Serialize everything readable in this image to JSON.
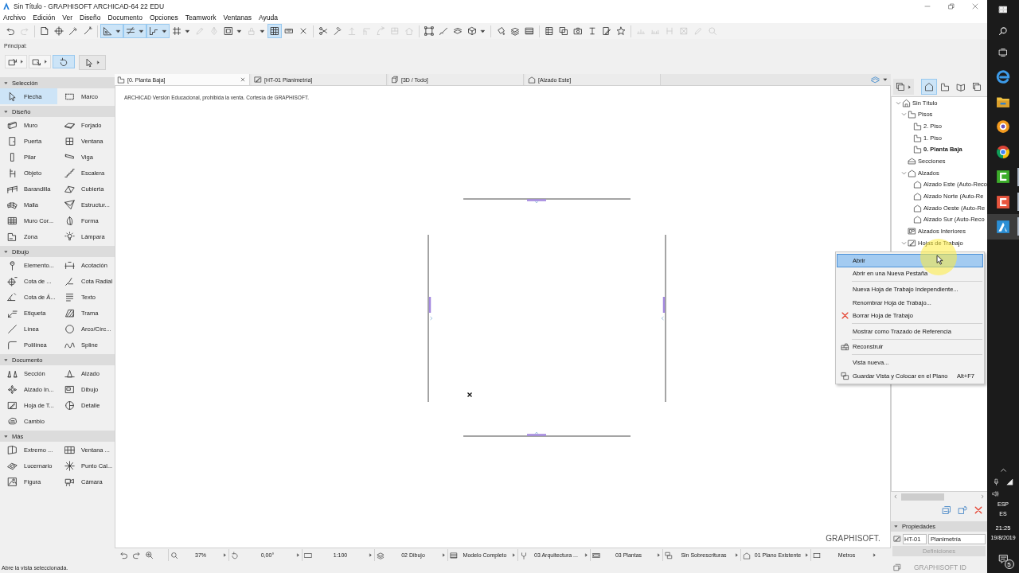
{
  "window": {
    "title": "Sin Título - GRAPHISOFT ARCHICAD-64 22 EDU"
  },
  "menu": [
    "Archivo",
    "Edición",
    "Ver",
    "Diseño",
    "Documento",
    "Opciones",
    "Teamwork",
    "Ventanas",
    "Ayuda"
  ],
  "toolbar": [
    [
      {
        "on": false,
        "disabled": false,
        "dropdown": false
      },
      {
        "on": false,
        "disabled": true,
        "dropdown": false
      }
    ],
    [
      {
        "on": false,
        "disabled": false,
        "dropdown": false
      },
      {
        "on": false,
        "disabled": false,
        "dropdown": false
      },
      {
        "on": false,
        "disabled": false,
        "dropdown": false
      },
      {
        "on": false,
        "disabled": false,
        "dropdown": false
      }
    ],
    [
      {
        "on": true,
        "disabled": false,
        "dropdown": true
      },
      {
        "on": true,
        "disabled": false,
        "dropdown": true
      },
      {
        "on": true,
        "disabled": false,
        "dropdown": true
      },
      {
        "on": false,
        "disabled": false,
        "dropdown": true
      },
      {
        "on": false,
        "disabled": true,
        "dropdown": false
      },
      {
        "on": false,
        "disabled": true,
        "dropdown": false
      },
      {
        "on": false,
        "disabled": false,
        "dropdown": true
      },
      {
        "on": false,
        "disabled": true,
        "dropdown": true
      },
      {
        "on": true,
        "disabled": false,
        "dropdown": false
      },
      {
        "on": false,
        "disabled": false,
        "dropdown": false
      },
      {
        "on": false,
        "disabled": false,
        "dropdown": false
      }
    ],
    [
      {
        "on": false,
        "disabled": false,
        "dropdown": false
      },
      {
        "on": false,
        "disabled": false,
        "dropdown": false
      },
      {
        "on": false,
        "disabled": true,
        "dropdown": false
      },
      {
        "on": false,
        "disabled": true,
        "dropdown": false
      },
      {
        "on": false,
        "disabled": true,
        "dropdown": false
      },
      {
        "on": false,
        "disabled": true,
        "dropdown": false
      },
      {
        "on": false,
        "disabled": true,
        "dropdown": false
      }
    ],
    [
      {
        "on": false,
        "disabled": false,
        "dropdown": false
      },
      {
        "on": false,
        "disabled": false,
        "dropdown": false
      },
      {
        "on": false,
        "disabled": false,
        "dropdown": false
      },
      {
        "on": false,
        "disabled": false,
        "dropdown": true
      }
    ],
    [
      {
        "on": false,
        "disabled": false,
        "dropdown": false
      },
      {
        "on": false,
        "disabled": false,
        "dropdown": false
      },
      {
        "on": false,
        "disabled": false,
        "dropdown": false
      }
    ],
    [
      {
        "on": false,
        "disabled": false,
        "dropdown": false
      },
      {
        "on": false,
        "disabled": false,
        "dropdown": false
      },
      {
        "on": false,
        "disabled": false,
        "dropdown": false
      },
      {
        "on": false,
        "disabled": false,
        "dropdown": false
      },
      {
        "on": false,
        "disabled": false,
        "dropdown": false
      },
      {
        "on": false,
        "disabled": false,
        "dropdown": false
      }
    ],
    [
      {
        "on": false,
        "disabled": true,
        "dropdown": false
      },
      {
        "on": false,
        "disabled": true,
        "dropdown": false
      },
      {
        "on": false,
        "disabled": true,
        "dropdown": false
      },
      {
        "on": false,
        "disabled": true,
        "dropdown": false
      },
      {
        "on": false,
        "disabled": true,
        "dropdown": false
      },
      {
        "on": false,
        "disabled": true,
        "dropdown": false
      }
    ]
  ],
  "principal": {
    "label": "Principal:",
    "buttons": [
      {
        "selected": false,
        "dropdown": true
      },
      {
        "selected": false,
        "dropdown": true
      },
      {
        "selected": true,
        "dropdown": false
      },
      {
        "selected": false,
        "dropdown": true
      }
    ]
  },
  "tabs": [
    {
      "label": "[0. Planta Baja]",
      "kind": "plan",
      "selected": true
    },
    {
      "label": "[HT-01 Planimetría]",
      "kind": "worksheet",
      "selected": false
    },
    {
      "label": "[3D / Todo]",
      "kind": "model",
      "selected": false
    },
    {
      "label": "[Alzado Este]",
      "kind": "elevation",
      "selected": false
    }
  ],
  "toolbox": [
    {
      "title": "Selección",
      "expanded": true,
      "items": [
        {
          "label": "Flecha",
          "selected": true
        },
        {
          "label": "Marco",
          "selected": false
        }
      ]
    },
    {
      "title": "Diseño",
      "expanded": true,
      "items": [
        {
          "label": "Muro",
          "selected": false
        },
        {
          "label": "Forjado",
          "selected": false
        },
        {
          "label": "Puerta",
          "selected": false
        },
        {
          "label": "Ventana",
          "selected": false
        },
        {
          "label": "Pilar",
          "selected": false
        },
        {
          "label": "Viga",
          "selected": false
        },
        {
          "label": "Objeto",
          "selected": false
        },
        {
          "label": "Escalera",
          "selected": false
        },
        {
          "label": "Barandilla",
          "selected": false
        },
        {
          "label": "Cubierta",
          "selected": false
        },
        {
          "label": "Malla",
          "selected": false
        },
        {
          "label": "Estructur...",
          "selected": false
        },
        {
          "label": "Muro Cor...",
          "selected": false
        },
        {
          "label": "Forma",
          "selected": false
        },
        {
          "label": "Zona",
          "selected": false
        },
        {
          "label": "Lámpara",
          "selected": false
        }
      ]
    },
    {
      "title": "Dibujo",
      "expanded": true,
      "items": [
        {
          "label": "Elemento...",
          "selected": false
        },
        {
          "label": "Acotación",
          "selected": false
        },
        {
          "label": "Cota de ...",
          "selected": false
        },
        {
          "label": "Cota Radial",
          "selected": false
        },
        {
          "label": "Cota de Á...",
          "selected": false
        },
        {
          "label": "Texto",
          "selected": false
        },
        {
          "label": "Etiqueta",
          "selected": false
        },
        {
          "label": "Trama",
          "selected": false
        },
        {
          "label": "Línea",
          "selected": false
        },
        {
          "label": "Arco/Círc...",
          "selected": false
        },
        {
          "label": "Polilínea",
          "selected": false
        },
        {
          "label": "Spline",
          "selected": false
        }
      ]
    },
    {
      "title": "Documento",
      "expanded": true,
      "items": [
        {
          "label": "Sección",
          "selected": false
        },
        {
          "label": "Alzado",
          "selected": false
        },
        {
          "label": "Alzado In...",
          "selected": false
        },
        {
          "label": "Dibujo",
          "selected": false
        },
        {
          "label": "Hoja de T...",
          "selected": false
        },
        {
          "label": "Detalle",
          "selected": false
        },
        {
          "label": "Cambio",
          "selected": false
        }
      ]
    },
    {
      "title": "Más",
      "expanded": true,
      "items": [
        {
          "label": "Extremo ...",
          "selected": false
        },
        {
          "label": "Ventana ...",
          "selected": false
        },
        {
          "label": "Lucernario",
          "selected": false
        },
        {
          "label": "Punto Cal...",
          "selected": false
        },
        {
          "label": "Figura",
          "selected": false
        },
        {
          "label": "Cámara",
          "selected": false
        }
      ]
    }
  ],
  "canvas": {
    "notice": "ARCHICAD Versión Educacional, prohibida la venta. Cortesía de GRAPHISOFT.",
    "logo": "GRAPHISOFT."
  },
  "view_bar": [
    "37%",
    "0,00°",
    "1:100",
    "02 Dibujo",
    "Modelo Completo",
    "03 Arquitectura ...",
    "03 Plantas",
    "Sin Sobrescrituras",
    "01 Plano Existente",
    "Metros"
  ],
  "navigator": {
    "modes": [
      {
        "selected": true
      },
      {
        "selected": false
      },
      {
        "selected": false
      },
      {
        "selected": false
      }
    ],
    "tree": [
      {
        "label": "Sin Título",
        "kind": "project",
        "expanded": true,
        "children": [
          {
            "label": "Pisos",
            "kind": "floor",
            "expanded": true,
            "children": [
              {
                "label": "2. Piso",
                "kind": "floor",
                "current": false
              },
              {
                "label": "1. Piso",
                "kind": "floor",
                "current": false
              },
              {
                "label": "0. Planta Baja",
                "kind": "floor",
                "current": true
              }
            ]
          },
          {
            "label": "Secciones",
            "kind": "section"
          },
          {
            "label": "Alzados",
            "kind": "elevation",
            "expanded": true,
            "children": [
              {
                "label": "Alzado Este (Auto-Reco",
                "kind": "elevation"
              },
              {
                "label": "Alzado Norte (Auto-Re",
                "kind": "elevation"
              },
              {
                "label": "Alzado Oeste (Auto-Re",
                "kind": "elevation"
              },
              {
                "label": "Alzado Sur (Auto-Reco",
                "kind": "elevation"
              }
            ]
          },
          {
            "label": "Alzados Interiores",
            "kind": "interior"
          },
          {
            "label": "Hojas de Trabajo",
            "kind": "worksheet",
            "expanded": true
          }
        ]
      }
    ]
  },
  "context_menu": {
    "items": [
      {
        "kind": "item",
        "label": "Abrir",
        "selected": true
      },
      {
        "kind": "item",
        "label": "Abrir en una Nueva Pestaña",
        "selected": false
      },
      {
        "kind": "separator"
      },
      {
        "kind": "item",
        "label": "Nueva Hoja de Trabajo Independiente...",
        "selected": false
      },
      {
        "kind": "item",
        "label": "Renombrar Hoja de Trabajo...",
        "selected": false
      },
      {
        "kind": "item",
        "label": "Borrar Hoja de Trabajo",
        "selected": false
      },
      {
        "kind": "separator"
      },
      {
        "kind": "item",
        "label": "Mostrar como Trazado de Referencia",
        "selected": false
      },
      {
        "kind": "separator"
      },
      {
        "kind": "item",
        "label": "Reconstruir",
        "selected": false
      },
      {
        "kind": "separator"
      },
      {
        "kind": "item",
        "label": "Vista nueva...",
        "selected": false
      },
      {
        "kind": "item",
        "label": "Guardar Vista y Colocar en el Plano",
        "shortcut": "Alt+F7",
        "selected": false
      }
    ]
  },
  "properties": {
    "title": "Propiedades",
    "expanded": true,
    "id": "HT-01",
    "name": "Planimetría",
    "button": {
      "label": "Definiciones",
      "disabled": true
    }
  },
  "status": {
    "message": "Abre la vista seleccionada.",
    "account": "GRAPHISOFT ID"
  },
  "taskbar": {
    "apps": [
      {
        "running": false,
        "active": false
      },
      {
        "running": false,
        "active": false
      },
      {
        "running": false,
        "active": false
      },
      {
        "running": false,
        "active": false
      },
      {
        "running": true,
        "active": false
      },
      {
        "running": true,
        "active": false
      },
      {
        "running": true,
        "active": true
      }
    ],
    "language": "ESP",
    "layout": "ES",
    "time": "21:25",
    "date": "19/8/2019",
    "notifications": "5"
  }
}
